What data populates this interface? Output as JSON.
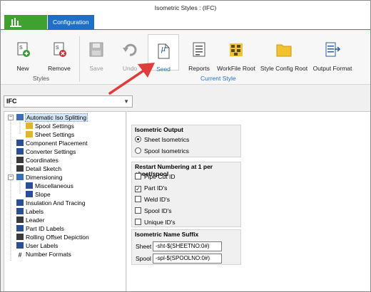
{
  "window": {
    "title": "Isometric Styles : (IFC)"
  },
  "tabs": {
    "active": "Configuration"
  },
  "ribbon": {
    "buttons": {
      "new": "New",
      "remove": "Remove",
      "save": "Save",
      "undo": "Undo",
      "seed": "Seed",
      "reports": "Reports",
      "workfile_root": "WorkFile Root",
      "style_config_root": "Style Config Root",
      "output_format": "Output Format"
    },
    "groups": {
      "styles": "Styles",
      "current_style": "Current Style"
    },
    "seed_icon_glyph": "µ"
  },
  "style_select": {
    "value": "IFC"
  },
  "tree": {
    "items": [
      {
        "label": "Automatic Iso Splitting",
        "icon": "split-icon"
      },
      {
        "label": "Spool Settings",
        "icon": "spool-icon"
      },
      {
        "label": "Sheet Settings",
        "icon": "sheet-icon"
      },
      {
        "label": "Component Placement",
        "icon": "component-icon"
      },
      {
        "label": "Converter Settings",
        "icon": "converter-icon"
      },
      {
        "label": "Coordinates",
        "icon": "coordinates-icon"
      },
      {
        "label": "Detail Sketch",
        "icon": "detail-icon"
      },
      {
        "label": "Dimensioning",
        "icon": "dimension-icon"
      },
      {
        "label": "Miscellaneous",
        "icon": "misc-icon"
      },
      {
        "label": "Slope",
        "icon": "slope-icon"
      },
      {
        "label": "Insulation And Tracing",
        "icon": "insulation-icon"
      },
      {
        "label": "Labels",
        "icon": "labels-icon"
      },
      {
        "label": "Leader",
        "icon": "leader-icon"
      },
      {
        "label": "Part ID Labels",
        "icon": "partid-icon"
      },
      {
        "label": "Rolling Offset Depiction",
        "icon": "rolling-icon"
      },
      {
        "label": "User Labels",
        "icon": "userlabel-icon"
      },
      {
        "label": "Number Formats",
        "icon": "hash-icon"
      }
    ]
  },
  "isometric_output": {
    "title": "Isometric Output",
    "options": [
      "Sheet Isometrics",
      "Spool Isometrics"
    ],
    "selected": "Sheet Isometrics"
  },
  "restart_numbering": {
    "title": "Restart Numbering at 1 per sheet/spool",
    "options": [
      {
        "label": "Pipe Cut ID",
        "checked": false
      },
      {
        "label": "Part ID's",
        "checked": true
      },
      {
        "label": "Weld ID's",
        "checked": false
      },
      {
        "label": "Spool ID's",
        "checked": false
      },
      {
        "label": "Unique ID's",
        "checked": false
      }
    ],
    "check_glyph": "✓"
  },
  "name_suffix": {
    "title": "Isometric Name Suffix",
    "sheet_label": "Sheet",
    "sheet_value": "-sht-$(SHEETNO:0#)",
    "spool_label": "Spool",
    "spool_value": "-spl-$(SPOOLNO:0#)"
  },
  "colors": {
    "accent": "#1e6fc8",
    "app_green": "#3fa22f",
    "arrow": "#e03c3c"
  }
}
